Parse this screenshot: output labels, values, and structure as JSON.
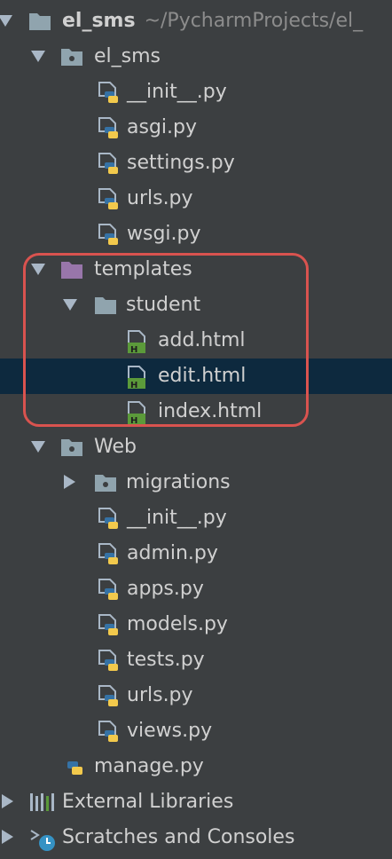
{
  "tree": {
    "root": {
      "label": "el_sms",
      "path": "~/PycharmProjects/el_"
    },
    "el_sms_pkg": {
      "label": "el_sms",
      "files": [
        "__init__.py",
        "asgi.py",
        "settings.py",
        "urls.py",
        "wsgi.py"
      ]
    },
    "templates": {
      "label": "templates",
      "student": {
        "label": "student",
        "files": [
          "add.html",
          "edit.html",
          "index.html"
        ]
      }
    },
    "web": {
      "label": "Web",
      "migrations": "migrations",
      "files": [
        "__init__.py",
        "admin.py",
        "apps.py",
        "models.py",
        "tests.py",
        "urls.py",
        "views.py"
      ]
    },
    "manage": "manage.py",
    "external_libraries": "External Libraries",
    "scratches": "Scratches and Consoles"
  },
  "colors": {
    "background": "#3c3f41",
    "selection": "#0d293e",
    "highlight_border": "#d9534f",
    "folder": "#90a4ae",
    "templates_folder": "#9876aa",
    "html_green": "#5b9a3a"
  }
}
